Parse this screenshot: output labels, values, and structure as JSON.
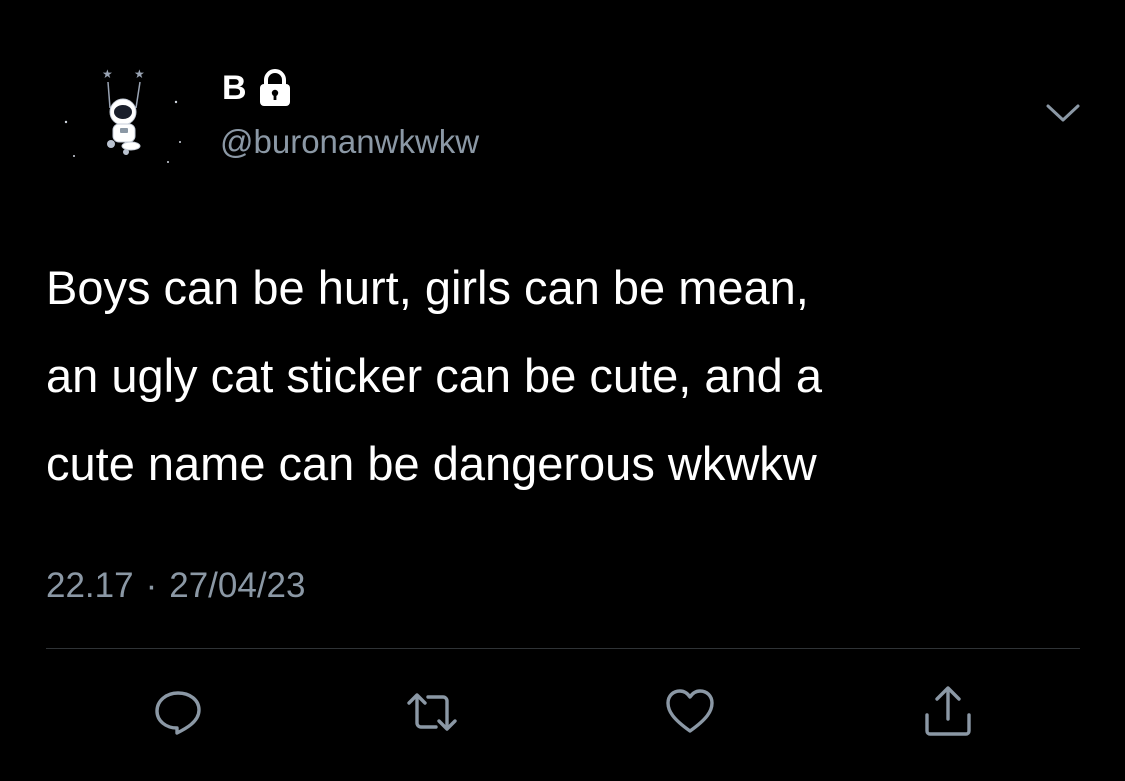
{
  "author": {
    "display_name": "B",
    "handle": "@buronanwkwkw",
    "protected_icon": "lock-icon",
    "avatar_icon": "astronaut-on-moon-avatar"
  },
  "tweet": {
    "text": "Boys can be hurt, girls can be mean,\nan ugly cat sticker can be cute, and a\ncute name can be dangerous wkwkw",
    "time": "22.17",
    "separator": "·",
    "date": "27/04/23"
  },
  "actions": [
    {
      "name": "reply",
      "icon": "reply-icon"
    },
    {
      "name": "retweet",
      "icon": "retweet-icon"
    },
    {
      "name": "like",
      "icon": "heart-icon"
    },
    {
      "name": "share",
      "icon": "share-icon"
    }
  ],
  "colors": {
    "background": "#000000",
    "text": "#ffffff",
    "secondary_text": "#8b98a5",
    "divider": "#2f3336"
  }
}
